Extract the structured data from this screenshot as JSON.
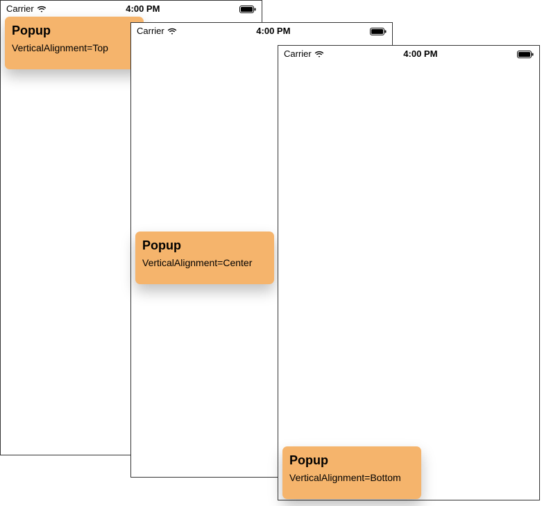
{
  "statusBar": {
    "carrier": "Carrier",
    "time": "4:00 PM"
  },
  "phones": {
    "phone1": {
      "popup": {
        "title": "Popup",
        "subtitle": "VerticalAlignment=Top"
      }
    },
    "phone2": {
      "popup": {
        "title": "Popup",
        "subtitle": "VerticalAlignment=Center"
      }
    },
    "phone3": {
      "popup": {
        "title": "Popup",
        "subtitle": "VerticalAlignment=Bottom"
      }
    }
  }
}
